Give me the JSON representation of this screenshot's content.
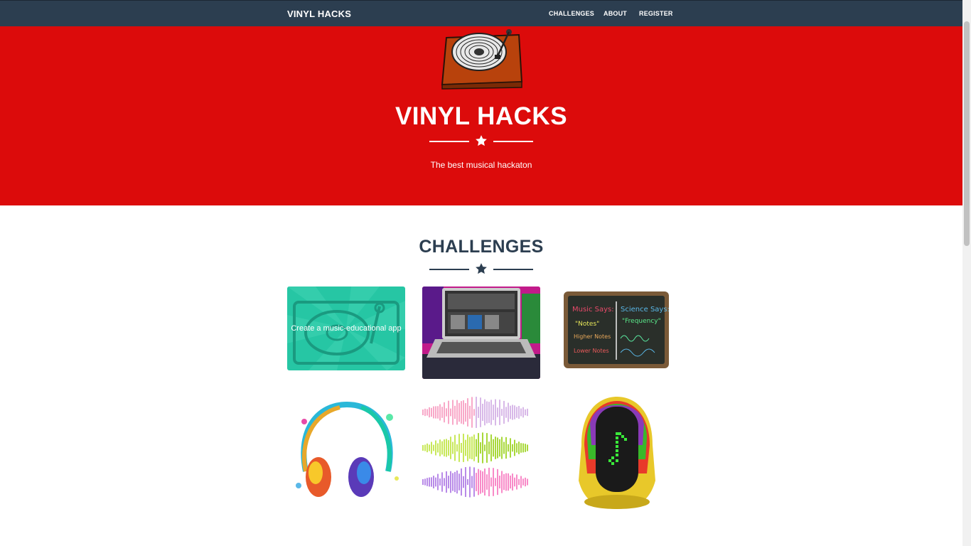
{
  "navbar": {
    "brand": "VINYL HACKS",
    "links": [
      "CHALLENGES",
      "ABOUT",
      "REGISTER"
    ],
    "bg_color": "#2c3e50"
  },
  "hero": {
    "title": "VINYL HACKS",
    "subtitle": "The best musical hackaton",
    "bg_color": "#dc0b0b"
  },
  "challenges": {
    "title": "CHALLENGES",
    "cards": [
      {
        "caption": "Create a music-educational app",
        "icon": "turntable-icon"
      },
      {
        "icon": "laptop-dj-image"
      },
      {
        "icon": "chalkboard-image"
      },
      {
        "icon": "headphones-image"
      },
      {
        "icon": "soundwaves-image"
      },
      {
        "icon": "robot-helmet-image"
      }
    ]
  }
}
